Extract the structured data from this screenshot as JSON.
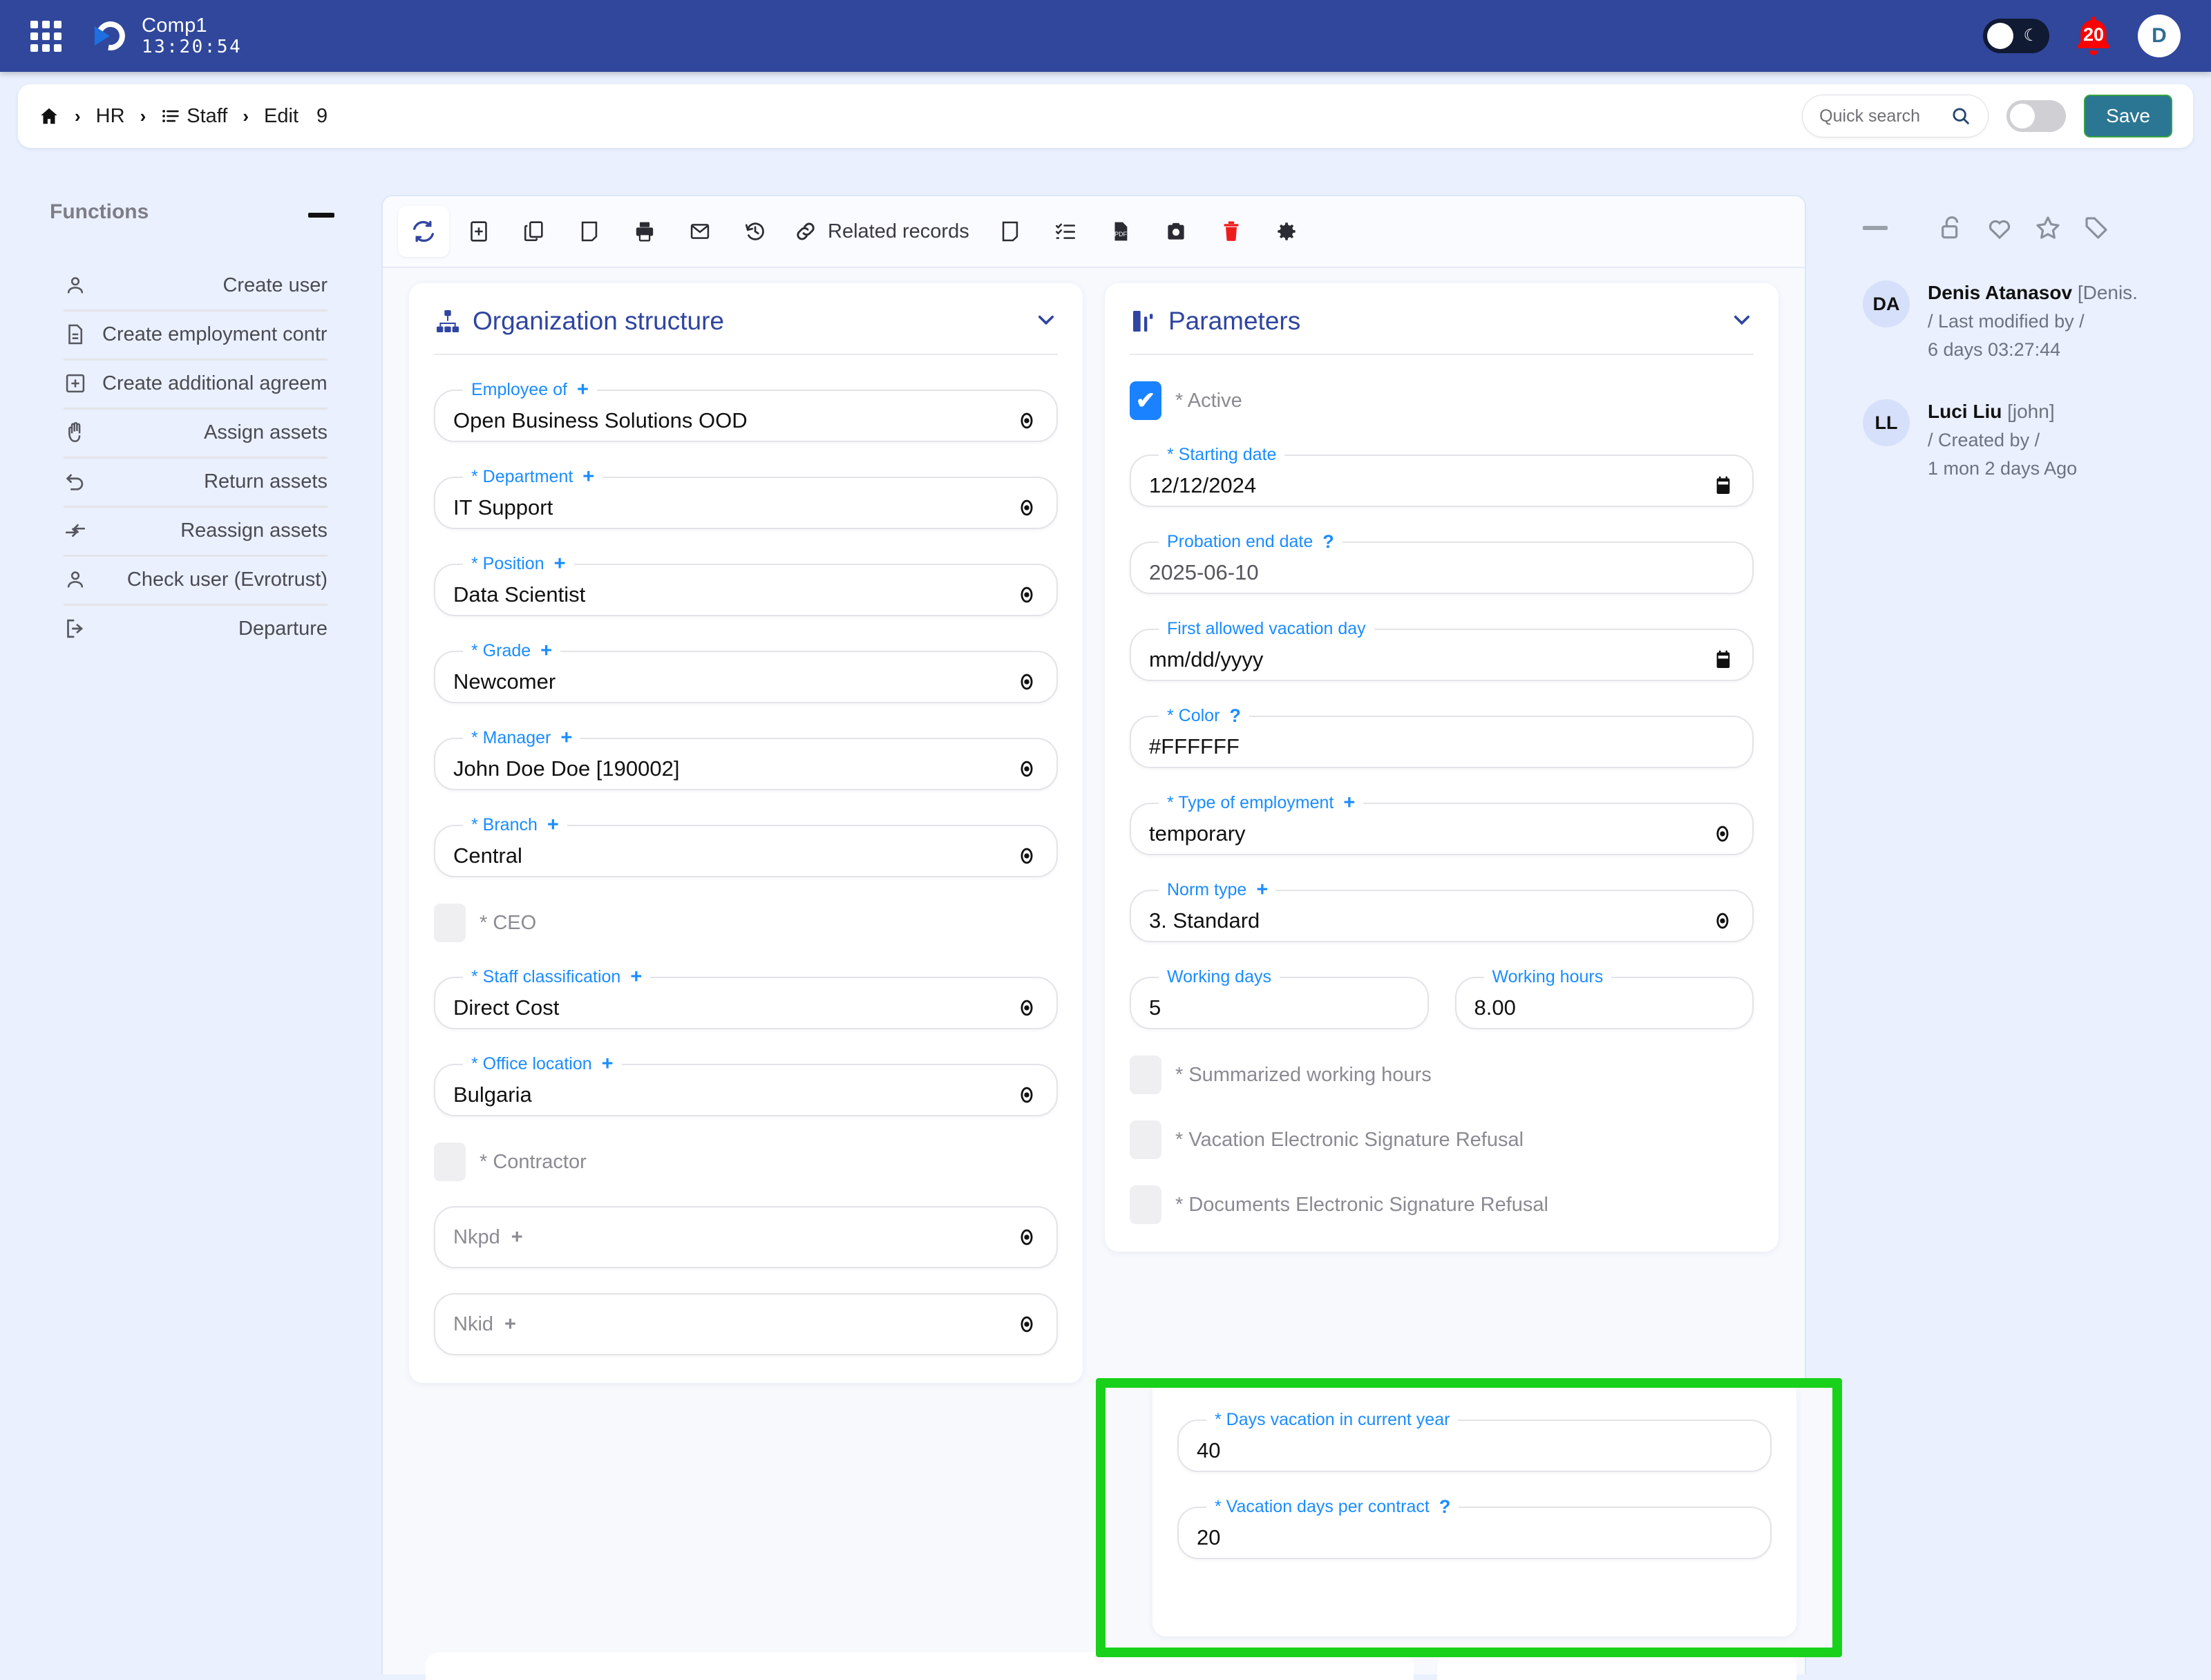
{
  "topbar": {
    "brand_name": "Comp1",
    "timer": "13:20:54",
    "notification_count": "20",
    "avatar_initial": "D",
    "accent_color": "#30479b"
  },
  "breadcrumb": {
    "home": "",
    "items": [
      "HR",
      "Staff"
    ],
    "action": "Edit",
    "record_id": "9",
    "separator": "›"
  },
  "search": {
    "placeholder": "Quick search",
    "value": ""
  },
  "actions": {
    "save_label": "Save"
  },
  "functions": {
    "title": "Functions",
    "items": [
      {
        "label": "Create user",
        "icon": "user-icon"
      },
      {
        "label": "Create employment contra",
        "icon": "document-icon"
      },
      {
        "label": "Create additional agreeme",
        "icon": "plus-square-icon"
      },
      {
        "label": "Assign assets",
        "icon": "hand-icon"
      },
      {
        "label": "Return assets",
        "icon": "undo-icon"
      },
      {
        "label": "Reassign assets",
        "icon": "swap-arrows-icon"
      },
      {
        "label": "Check user (Evrotrust)",
        "icon": "user-icon"
      },
      {
        "label": "Departure",
        "icon": "logout-icon"
      }
    ]
  },
  "toolbar": {
    "related_records_label": "Related records",
    "buttons": [
      "refresh-icon",
      "add-icon",
      "copy-icon",
      "note-icon",
      "print-icon",
      "email-icon",
      "history-icon",
      "link-icon",
      "sticky-note-icon",
      "checklist-icon",
      "pdf-icon",
      "camera-icon",
      "delete-icon",
      "settings-icon"
    ]
  },
  "org_structure": {
    "title": "Organization structure",
    "fields": [
      {
        "label": "Employee of",
        "required": false,
        "plus": true,
        "value": "Open Business Solutions OOD",
        "trailing": "eye-icon"
      },
      {
        "label": "Department",
        "required": true,
        "plus": true,
        "value": "IT Support",
        "trailing": "eye-icon"
      },
      {
        "label": "Position",
        "required": true,
        "plus": true,
        "value": "Data Scientist",
        "trailing": "eye-icon"
      },
      {
        "label": "Grade",
        "required": true,
        "plus": true,
        "value": "Newcomer",
        "trailing": "eye-icon"
      },
      {
        "label": "Manager",
        "required": true,
        "plus": true,
        "value": "John Doe Doe [190002]",
        "trailing": "eye-icon"
      },
      {
        "label": "Branch",
        "required": true,
        "plus": true,
        "value": "Central",
        "trailing": "eye-icon"
      }
    ],
    "ceo_checkbox": {
      "label": "* CEO",
      "checked": false
    },
    "fields2": [
      {
        "label": "Staff classification",
        "required": true,
        "plus": true,
        "value": "Direct Cost",
        "trailing": "eye-icon"
      },
      {
        "label": "Office location",
        "required": true,
        "plus": true,
        "value": "Bulgaria",
        "trailing": "eye-icon"
      }
    ],
    "contractor_checkbox": {
      "label": "* Contractor",
      "checked": false
    },
    "empty_fields": [
      {
        "placeholder": "Nkpd",
        "plus": true,
        "trailing": "eye-icon"
      },
      {
        "placeholder": "Nkid",
        "plus": true,
        "trailing": "eye-icon"
      }
    ]
  },
  "parameters": {
    "title": "Parameters",
    "active_checkbox": {
      "label": "* Active",
      "checked": true
    },
    "starting_date": {
      "label": "* Starting date",
      "value": "12/12/2024",
      "trailing": "calendar-icon"
    },
    "probation_end_date": {
      "label": "Probation end date",
      "help": "?",
      "value": "2025-06-10"
    },
    "first_allowed_vacation_day": {
      "label": "First allowed vacation day",
      "value": "mm/dd/yyyy",
      "trailing": "calendar-icon"
    },
    "color": {
      "label": "* Color",
      "help": "?",
      "value": "#FFFFFF"
    },
    "type_of_employment": {
      "label": "* Type of employment",
      "plus": true,
      "value": "temporary",
      "trailing": "eye-icon"
    },
    "norm_type": {
      "label": "Norm type",
      "plus": true,
      "value": "3. Standard",
      "trailing": "eye-icon"
    },
    "working_days": {
      "label": "Working days",
      "value": "5"
    },
    "working_hours": {
      "label": "Working hours",
      "value": "8.00"
    },
    "checkboxes": [
      {
        "label": "* Summarized working hours",
        "checked": false
      },
      {
        "label": "* Vacation Electronic Signature Refusal",
        "checked": false
      },
      {
        "label": "* Documents Electronic Signature Refusal",
        "checked": false
      }
    ],
    "days_vacation_current_year": {
      "label": "* Days vacation in current year",
      "value": "40"
    },
    "vacation_days_per_contract": {
      "label": "* Vacation days per contract",
      "help": "?",
      "value": "20"
    }
  },
  "record_info": {
    "entries": [
      {
        "initials": "DA",
        "name": "Denis Atanasov",
        "username": "[Denis.",
        "relation": "/ Last modified by /",
        "time": "6 days 03:27:44"
      },
      {
        "initials": "LL",
        "name": "Luci Liu",
        "username": "[john]",
        "relation": "/ Created by /",
        "time": "1 mon 2 days Ago"
      }
    ]
  },
  "highlight": {
    "color": "#19d11b"
  }
}
